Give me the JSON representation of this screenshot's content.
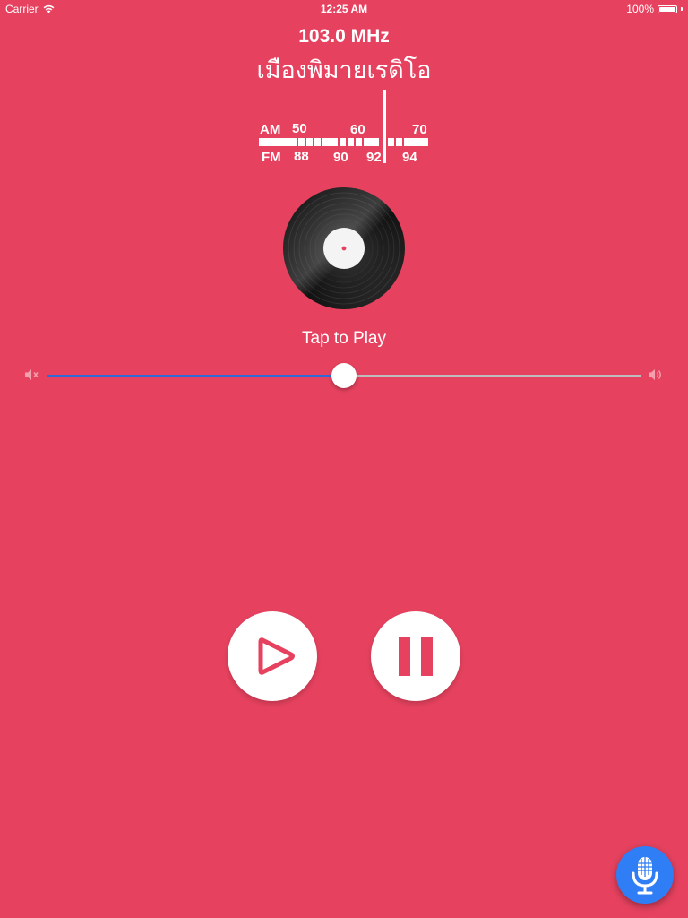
{
  "status_bar": {
    "carrier": "Carrier",
    "time": "12:25 AM",
    "battery": "100%",
    "wifi_icon": "wifi-icon",
    "battery_icon": "battery-icon"
  },
  "station": {
    "frequency": "103.0 MHz",
    "name": "เมืองพิมายเรดิโอ"
  },
  "dial": {
    "am_label": "AM",
    "fm_label": "FM",
    "am_ticks": [
      "50",
      "60",
      "70"
    ],
    "fm_ticks": [
      "88",
      "90",
      "92",
      "94"
    ]
  },
  "player": {
    "tap_label": "Tap to Play",
    "vinyl_icon": "vinyl-record-icon",
    "play_icon": "play-icon",
    "pause_icon": "pause-icon",
    "mic_icon": "microphone-icon"
  },
  "volume": {
    "level": 0.5,
    "min_icon": "volume-mute-icon",
    "max_icon": "volume-up-icon"
  },
  "colors": {
    "background": "#e6425f",
    "accent": "#e6425f",
    "slider_fill": "#2e6bd6",
    "mic_button": "#2f7ef5"
  }
}
